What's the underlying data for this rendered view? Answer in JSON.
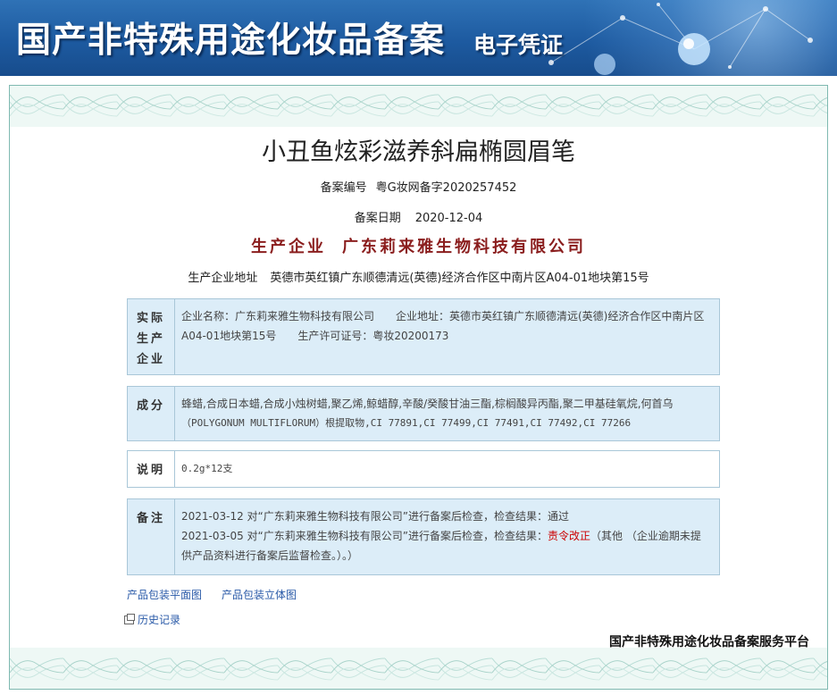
{
  "banner": {
    "title": "国产非特殊用途化妆品备案",
    "subtitle": "电子凭证"
  },
  "product": {
    "name": "小丑鱼炫彩滋养斜扁椭圆眉笔",
    "record_number_label": "备案编号",
    "record_number": "粤G妆网备字2020257452",
    "record_date_label": "备案日期",
    "record_date": "2020-12-04",
    "producer_label": "生产企业",
    "producer": "广东莉来雅生物科技有限公司",
    "producer_address_label": "生产企业地址",
    "producer_address": "英德市英红镇广东顺德清远(英德)经济合作区中南片区A04-01地块第15号"
  },
  "sections": {
    "actual_producer": {
      "label_lines": [
        "实际",
        "生产",
        "企业"
      ],
      "line1": "企业名称：广东莉来雅生物科技有限公司　　企业地址：英德市英红镇广东顺德清远(英德)经济合作区中南片区",
      "line2": "A04-01地块第15号　　生产许可证号：粤妆20200173"
    },
    "ingredients": {
      "label": "成分",
      "line1": "蜂蜡,合成日本蜡,合成小烛树蜡,聚乙烯,鲸蜡醇,辛酸/癸酸甘油三酯,棕榈酸异丙酯,聚二甲基硅氧烷,何首乌",
      "line2": "（POLYGONUM MULTIFLORUM）根提取物,CI 77891,CI 77499,CI 77491,CI 77492,CI 77266"
    },
    "description": {
      "label": "说明",
      "text": "0.2g*12支"
    },
    "remarks": {
      "label": "备注",
      "line1": "2021-03-12 对“广东莉来雅生物科技有限公司”进行备案后检查，检查结果：通过",
      "line2_prefix": "2021-03-05 对“广东莉来雅生物科技有限公司”进行备案后检查，检查结果：",
      "line2_result": "责令改正",
      "line2_suffix": "（其他 （企业逾期未提",
      "line3": "供产品资料进行备案后监督检查。）。）"
    }
  },
  "links": {
    "flat_image": "产品包装平面图",
    "stereo_image": "产品包装立体图",
    "history": "历史记录"
  },
  "footer": {
    "platform": "国产非特殊用途化妆品备案服务平台"
  },
  "colors": {
    "banner_blue": "#1d5aa0",
    "company_red": "#8a1d1d",
    "box_fill": "#dcedf8",
    "link_blue": "#2a5aa8",
    "alert_red": "#cc0000"
  }
}
